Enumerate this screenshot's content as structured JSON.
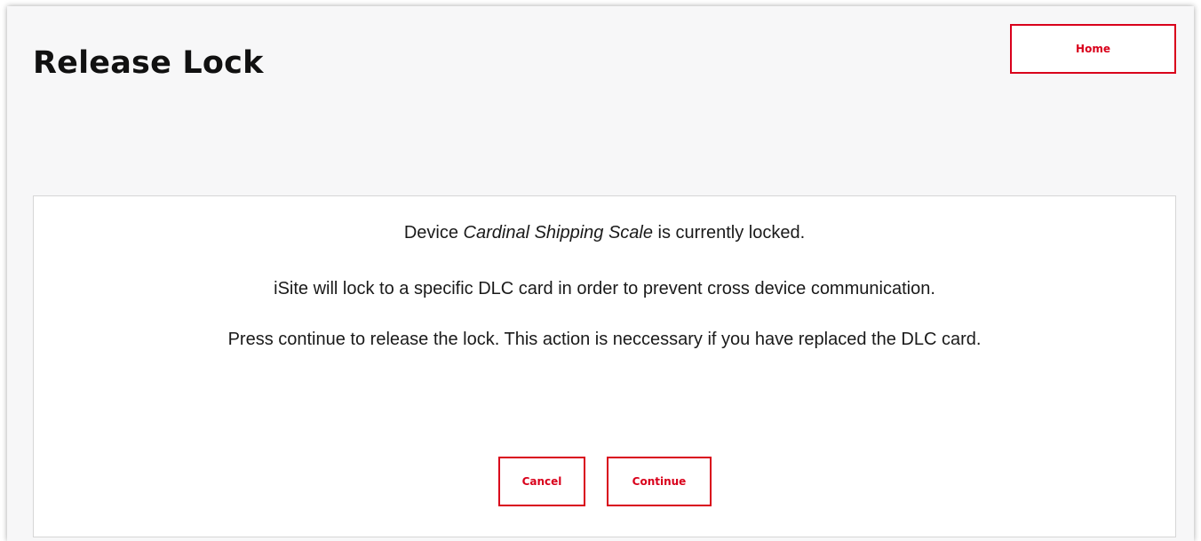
{
  "header": {
    "title": "Release Lock",
    "home_label": "Home"
  },
  "message": {
    "line1_prefix": "Device ",
    "device_name": "Cardinal Shipping Scale",
    "line1_suffix": " is currently locked.",
    "line2": "iSite will lock to a specific DLC card in order to prevent cross device communication.",
    "line3": "Press continue to release the lock. This action is neccessary if you have replaced the DLC card."
  },
  "actions": {
    "cancel_label": "Cancel",
    "continue_label": "Continue"
  },
  "colors": {
    "accent": "#d9001b",
    "background": "#f7f7f8",
    "card": "#ffffff"
  }
}
